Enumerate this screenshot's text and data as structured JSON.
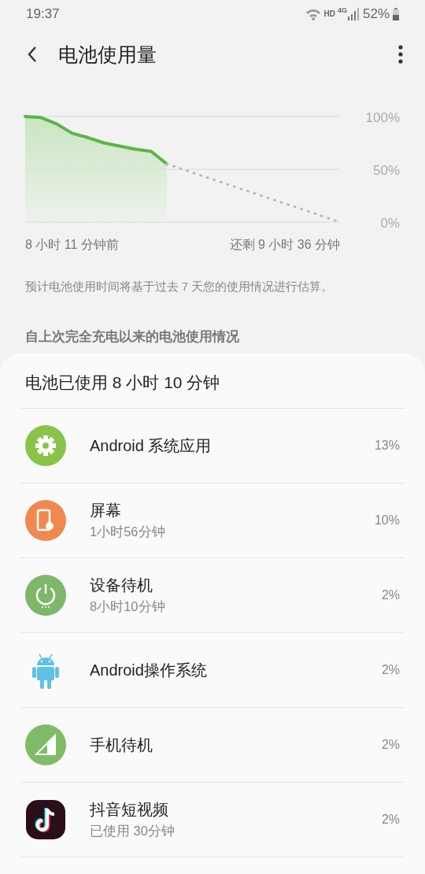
{
  "status_bar": {
    "time": "19:37",
    "hd": "HD",
    "network": "4G",
    "battery": "52%"
  },
  "app_bar": {
    "title": "电池使用量"
  },
  "chart": {
    "chart_data": {
      "type": "line",
      "categories": [
        null,
        null,
        null,
        null,
        null,
        null,
        null,
        null,
        null,
        null,
        null,
        null,
        null,
        null,
        null,
        null,
        null,
        null,
        null,
        null,
        null
      ],
      "series": [
        {
          "color": "#5cb545",
          "line_style": "solid",
          "values": [
            100,
            99,
            93,
            84,
            80,
            75,
            72,
            69,
            67,
            55,
            null,
            null,
            null,
            null,
            null,
            null,
            null,
            null,
            null,
            null,
            null
          ]
        },
        {
          "color": "#b0bcc4",
          "line_style": "dotted",
          "values": [
            null,
            null,
            null,
            null,
            null,
            null,
            null,
            null,
            null,
            55,
            50,
            45,
            40,
            35,
            30,
            25,
            20,
            15,
            10,
            5,
            0
          ]
        }
      ],
      "ylim": [
        0,
        100
      ],
      "yticks": [
        {
          "value": 0,
          "label": "0%"
        },
        {
          "value": 50,
          "label": "50%"
        },
        {
          "value": 100,
          "label": "100%"
        }
      ]
    },
    "start_label": "8 小时 11 分钟前",
    "end_label": "还剩 9 小时 36 分钟"
  },
  "note": "预计电池使用时间将基于过去 7 天您的使用情况进行估算。",
  "section_title": "自上次完全充电以来的电池使用情况",
  "usage": {
    "title": "电池已使用 8 小时 10 分钟",
    "items": [
      {
        "name": "Android 系统应用",
        "percent": "13%"
      },
      {
        "name": "屏幕",
        "detail": "1小时56分钟",
        "percent": "10%"
      },
      {
        "name": "设备待机",
        "detail": "8小时10分钟",
        "percent": "2%"
      },
      {
        "name": "Android操作系统",
        "percent": "2%"
      },
      {
        "name": "手机待机",
        "percent": "2%"
      },
      {
        "name": "抖音短视频",
        "detail": "已使用 30分钟",
        "percent": "2%"
      }
    ]
  }
}
